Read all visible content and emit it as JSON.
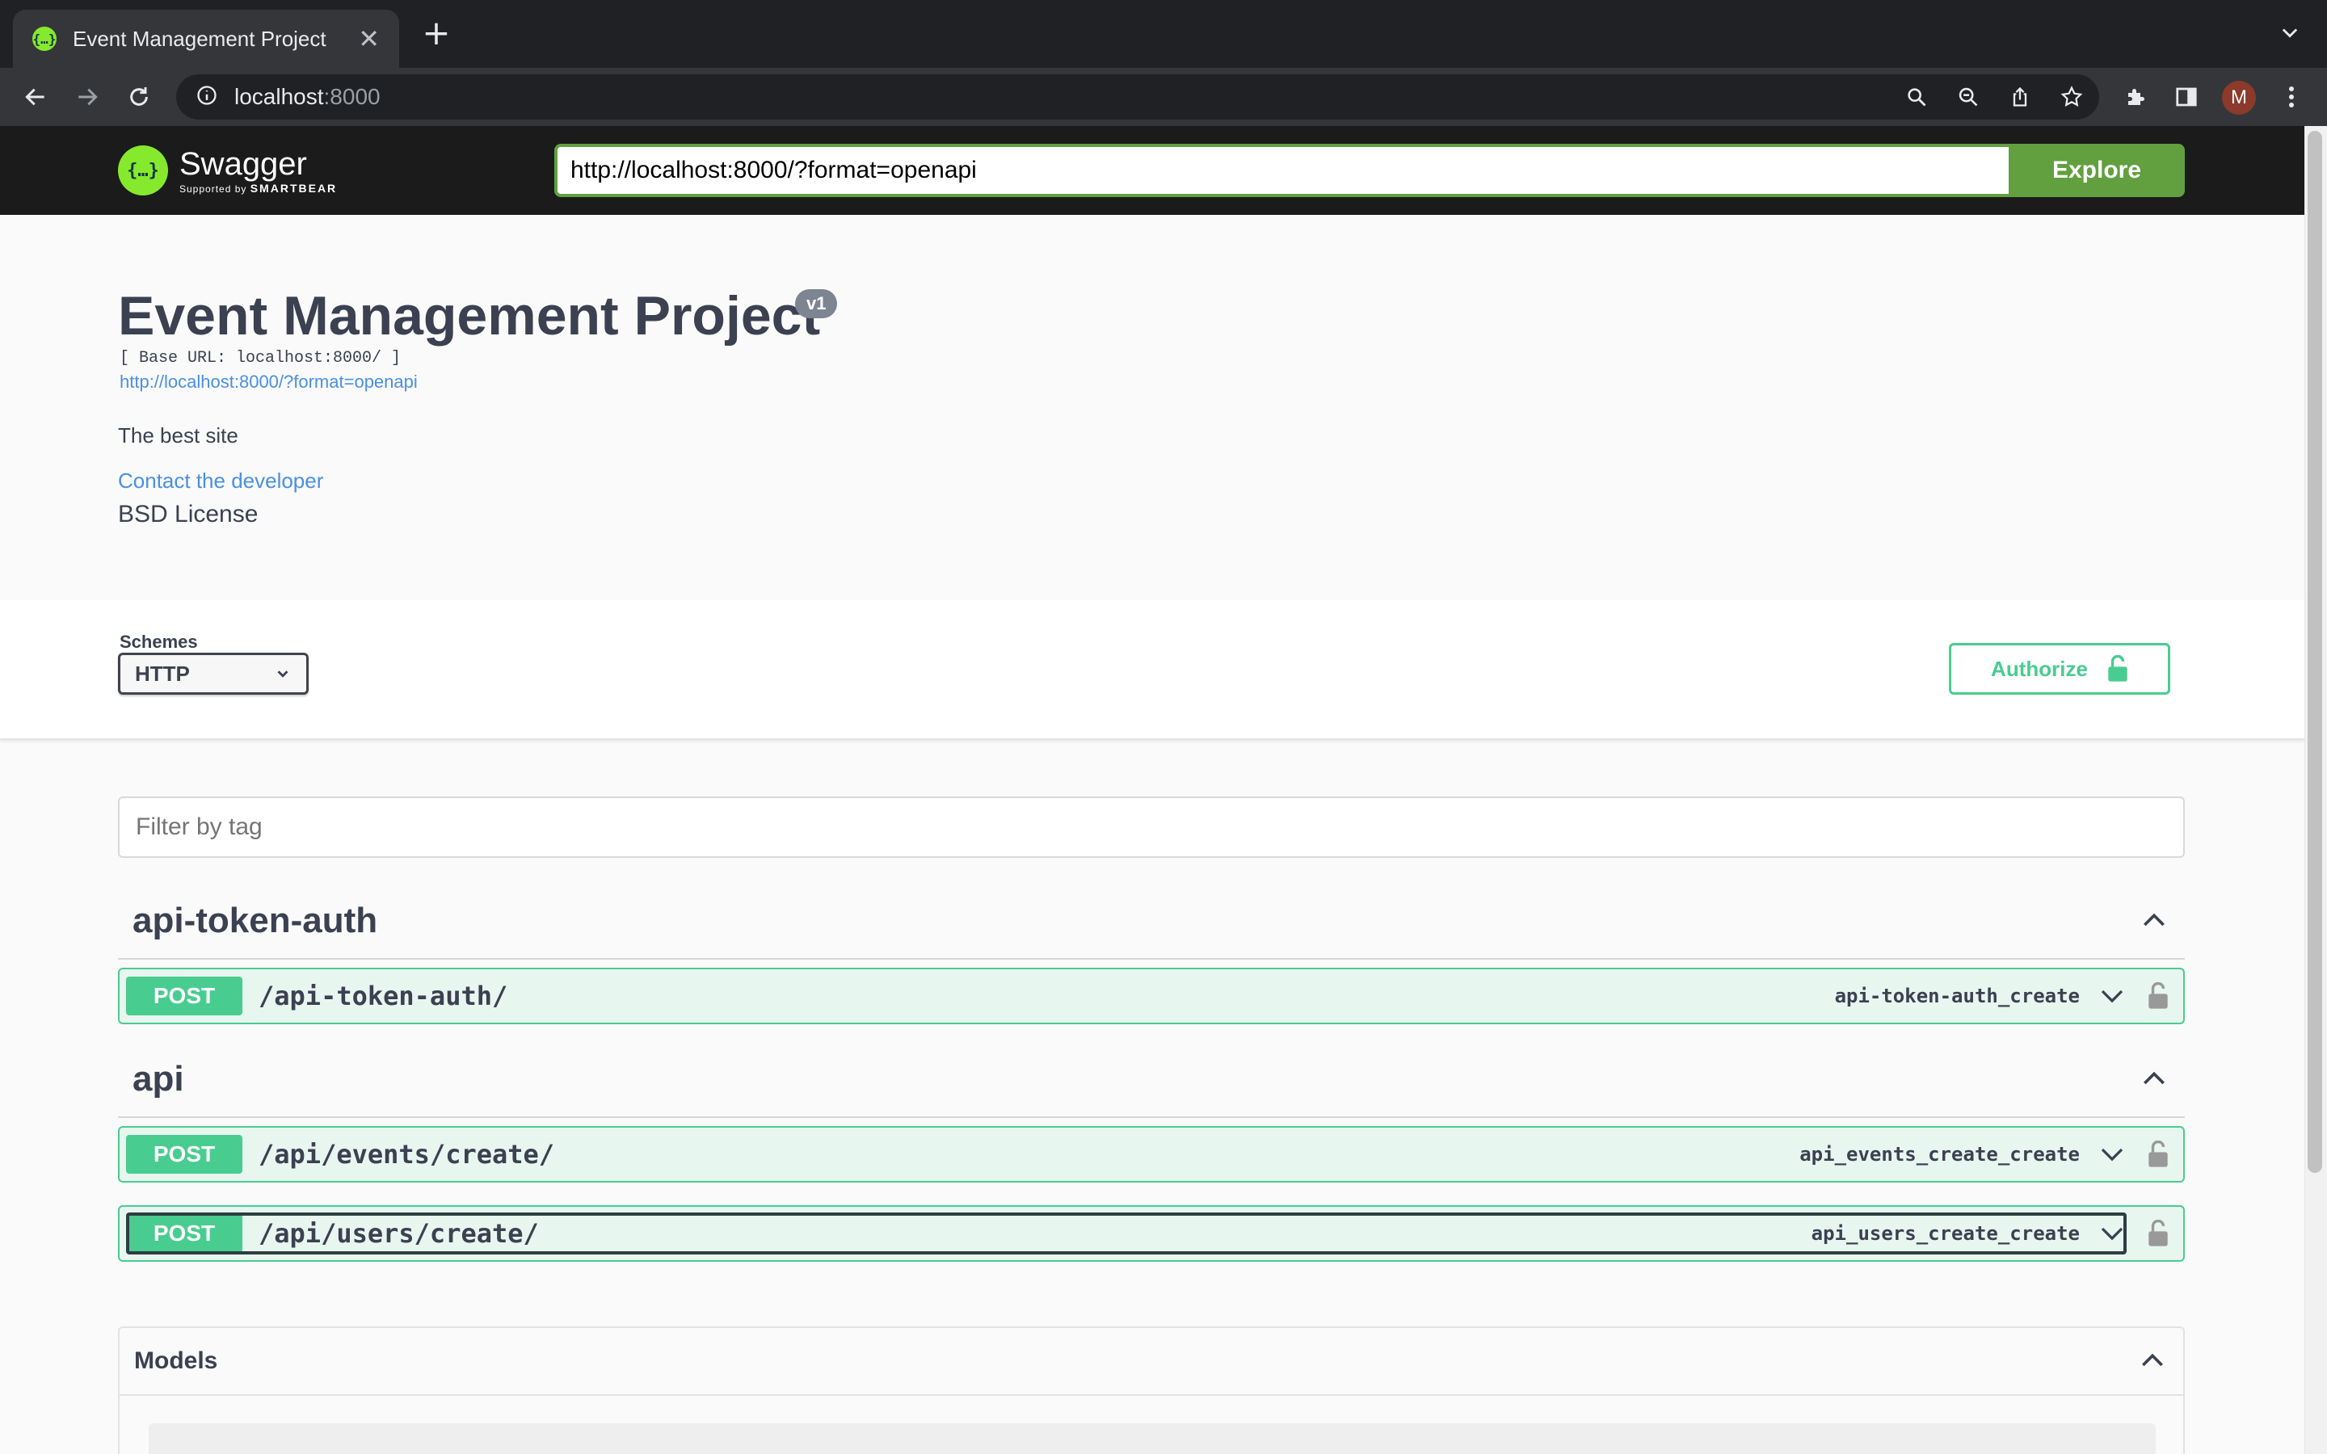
{
  "browser": {
    "tab_title": "Event Management Project",
    "address_host": "localhost",
    "address_port": ":8000",
    "profile_initial": "M",
    "new_tab": "+",
    "close_tab": "✕"
  },
  "swagger_topbar": {
    "brand": "Swagger",
    "brand_sub_prefix": "Supported by ",
    "brand_sub_company": "SMARTBEAR",
    "spec_url": "http://localhost:8000/?format=openapi",
    "explore_label": "Explore"
  },
  "info": {
    "title": "Event Management Project",
    "version": "v1",
    "base_url": "[ Base URL: localhost:8000/ ]",
    "spec_link": "http://localhost:8000/?format=openapi",
    "description": "The best site",
    "contact": "Contact the developer",
    "license": "BSD License"
  },
  "schemes": {
    "label": "Schemes",
    "selected": "HTTP"
  },
  "authorize_label": "Authorize",
  "filter_placeholder": "Filter by tag",
  "tags": [
    {
      "name": "api-token-auth",
      "operations": [
        {
          "method": "POST",
          "path": "/api-token-auth/",
          "operation_id": "api-token-auth_create"
        }
      ]
    },
    {
      "name": "api",
      "operations": [
        {
          "method": "POST",
          "path": "/api/events/create/",
          "operation_id": "api_events_create_create"
        },
        {
          "method": "POST",
          "path": "/api/users/create/",
          "operation_id": "api_users_create_create"
        }
      ]
    }
  ],
  "models_label": "Models",
  "colors": {
    "post_green": "#49cc90",
    "post_bg": "#e8f6f0",
    "explore_green": "#62a03f",
    "link_blue": "#4990e2",
    "swagger_lime": "#85ea2d"
  }
}
